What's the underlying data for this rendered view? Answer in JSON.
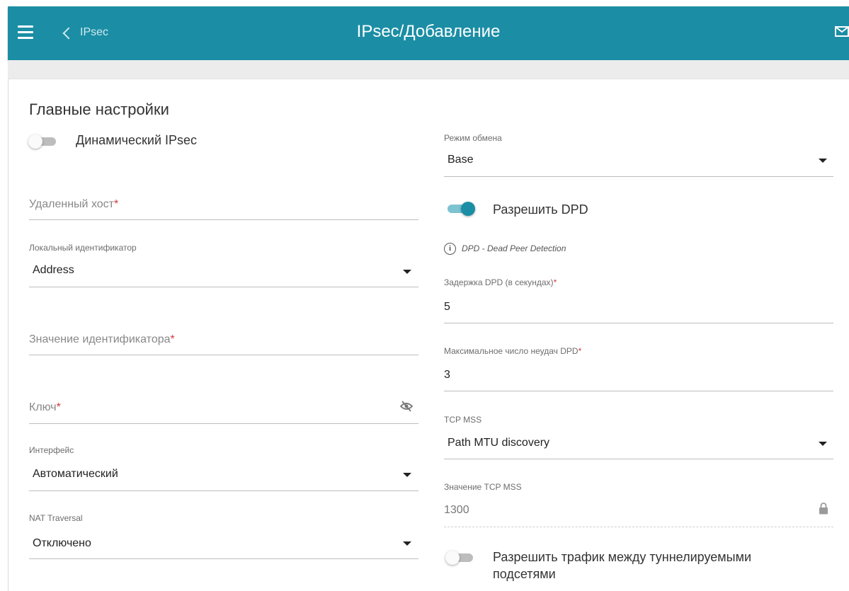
{
  "header": {
    "back_label": "IPsec",
    "title": "IPsec/Добавление"
  },
  "left": {
    "section_title": "Главные настройки",
    "dynamic_toggle_label": "Динамический IPsec",
    "remote_host_placeholder": "Удаленный хост",
    "local_id_label": "Локальный идентификатор",
    "local_id_value": "Address",
    "id_value_placeholder": "Значение идентификатора",
    "key_placeholder": "Ключ",
    "interface_label": "Интерфейс",
    "interface_value": "Автоматический",
    "nat_label": "NAT Traversal",
    "nat_value": "Отключено",
    "required_mark": "*"
  },
  "right": {
    "exchange_mode_label": "Режим обмена",
    "exchange_mode_value": "Base",
    "dpd_toggle_label": "Разрешить DPD",
    "dpd_info": "DPD - Dead Peer Detection",
    "dpd_delay_label": "Задержка DPD (в секундах)",
    "dpd_delay_value": "5",
    "dpd_max_fail_label": "Максимальное число неудач DPD",
    "dpd_max_fail_value": "3",
    "tcp_mss_label": "TCP MSS",
    "tcp_mss_value": "Path MTU discovery",
    "tcp_mss_value_label": "Значение TCP MSS",
    "tcp_mss_value_value": "1300",
    "traffic_toggle_label_line1": "Разрешить трафик между туннелируемыми",
    "traffic_toggle_label_line2": "подсетями",
    "required_mark": "*"
  },
  "states": {
    "dynamic_ipsec": false,
    "allow_dpd": true,
    "allow_tunnel_traffic": false
  },
  "colors": {
    "header_bg": "#1b8ea5",
    "toggle_on": "#1b8ea5",
    "required": "#d0393e"
  },
  "icons": {
    "menu": "hamburger-menu-icon",
    "back": "chevron-left-icon",
    "mail": "mail-icon",
    "eye": "eye-slash-icon",
    "lock": "lock-icon",
    "info": "info-icon",
    "dropdown": "caret-down-icon"
  }
}
